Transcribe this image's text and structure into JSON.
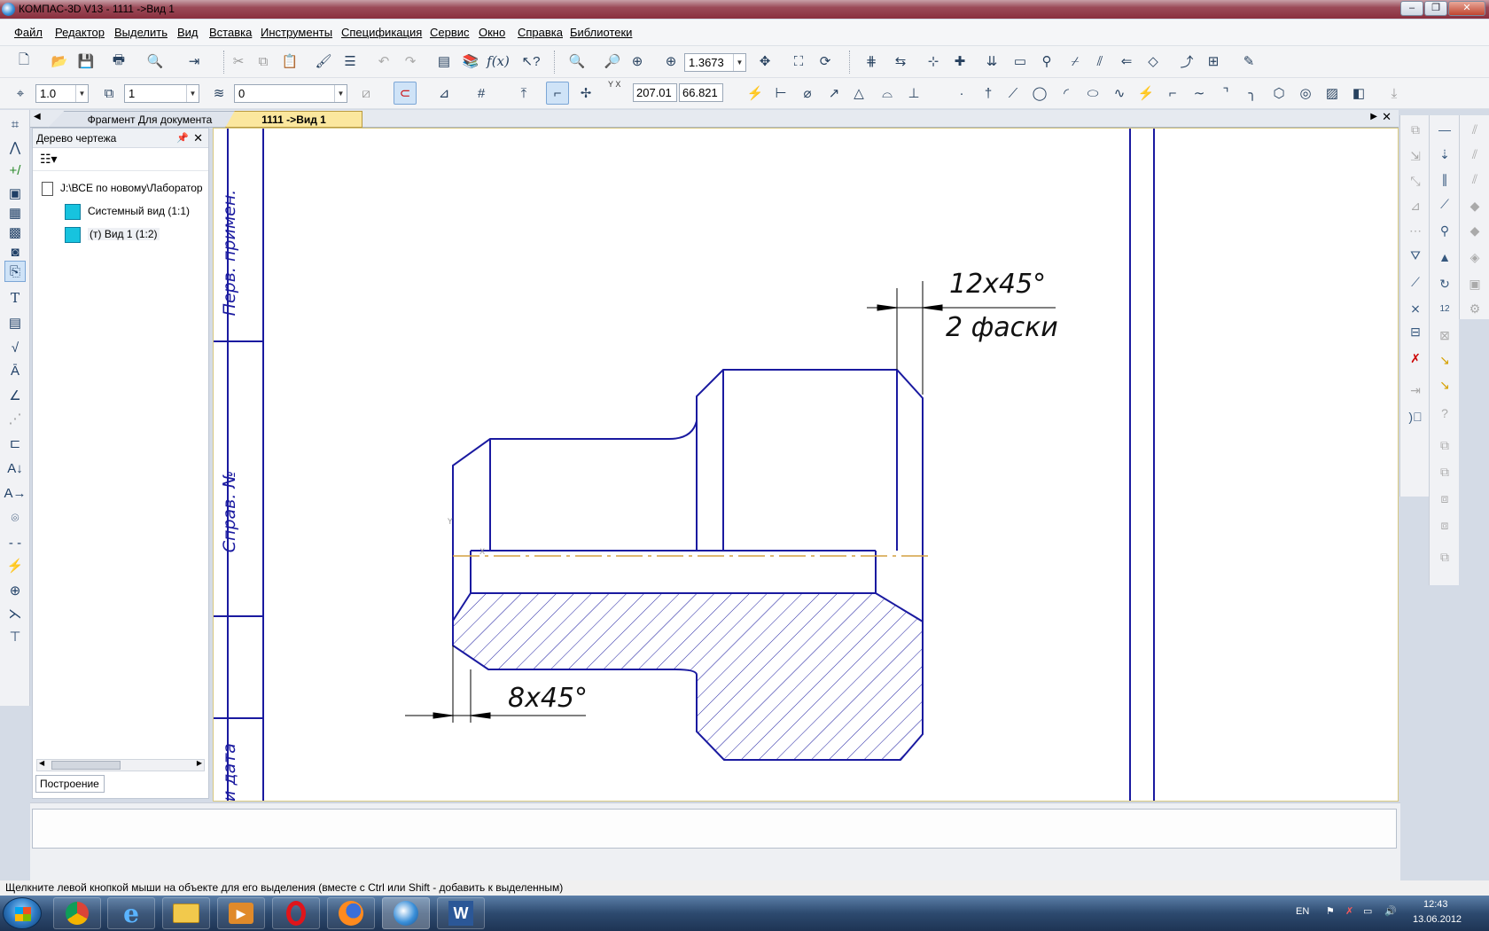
{
  "window": {
    "title": "КОМПАС-3D V13 - 1111 ->Вид 1"
  },
  "menu": {
    "items": [
      "Файл",
      "Редактор",
      "Выделить",
      "Вид",
      "Вставка",
      "Инструменты",
      "Спецификация",
      "Сервис",
      "Окно",
      "Справка",
      "Библиотеки"
    ]
  },
  "toolbar": {
    "zoom_value": "1.3673",
    "line_scale": "1.0",
    "view_number": "1",
    "layer_number": "0",
    "coord_x": "207.01",
    "coord_y": "66.821"
  },
  "tabs": {
    "fragment": "Фрагмент Для документа",
    "active": "1111 ->Вид 1"
  },
  "tree": {
    "panel_title": "Дерево чертежа",
    "root_path": "J:\\ВСЕ по новому\\Лаборатор",
    "items": [
      "Системный вид (1:1)",
      "(т) Вид 1 (1:2)"
    ],
    "bottom_tab": "Построение"
  },
  "drawing": {
    "stamp_labels": [
      "Перв. примен.",
      "Справ. №",
      "и дата"
    ],
    "dimension_top_value": "12x45°",
    "dimension_top_note": "2 фаски",
    "dimension_bottom_value": "8x45°",
    "axis_x_label": "X",
    "axis_y_label": "Y"
  },
  "status": {
    "hint": "Щелкните левой кнопкой мыши на объекте для его выделения (вместе с Ctrl или Shift - добавить к выделенным)"
  },
  "tray": {
    "language": "EN",
    "time": "12:43",
    "date": "13.06.2012"
  },
  "colors": {
    "drawing_line": "#1a1aa0",
    "axis_line": "#d4a040",
    "active_tab": "#fbe79e"
  }
}
